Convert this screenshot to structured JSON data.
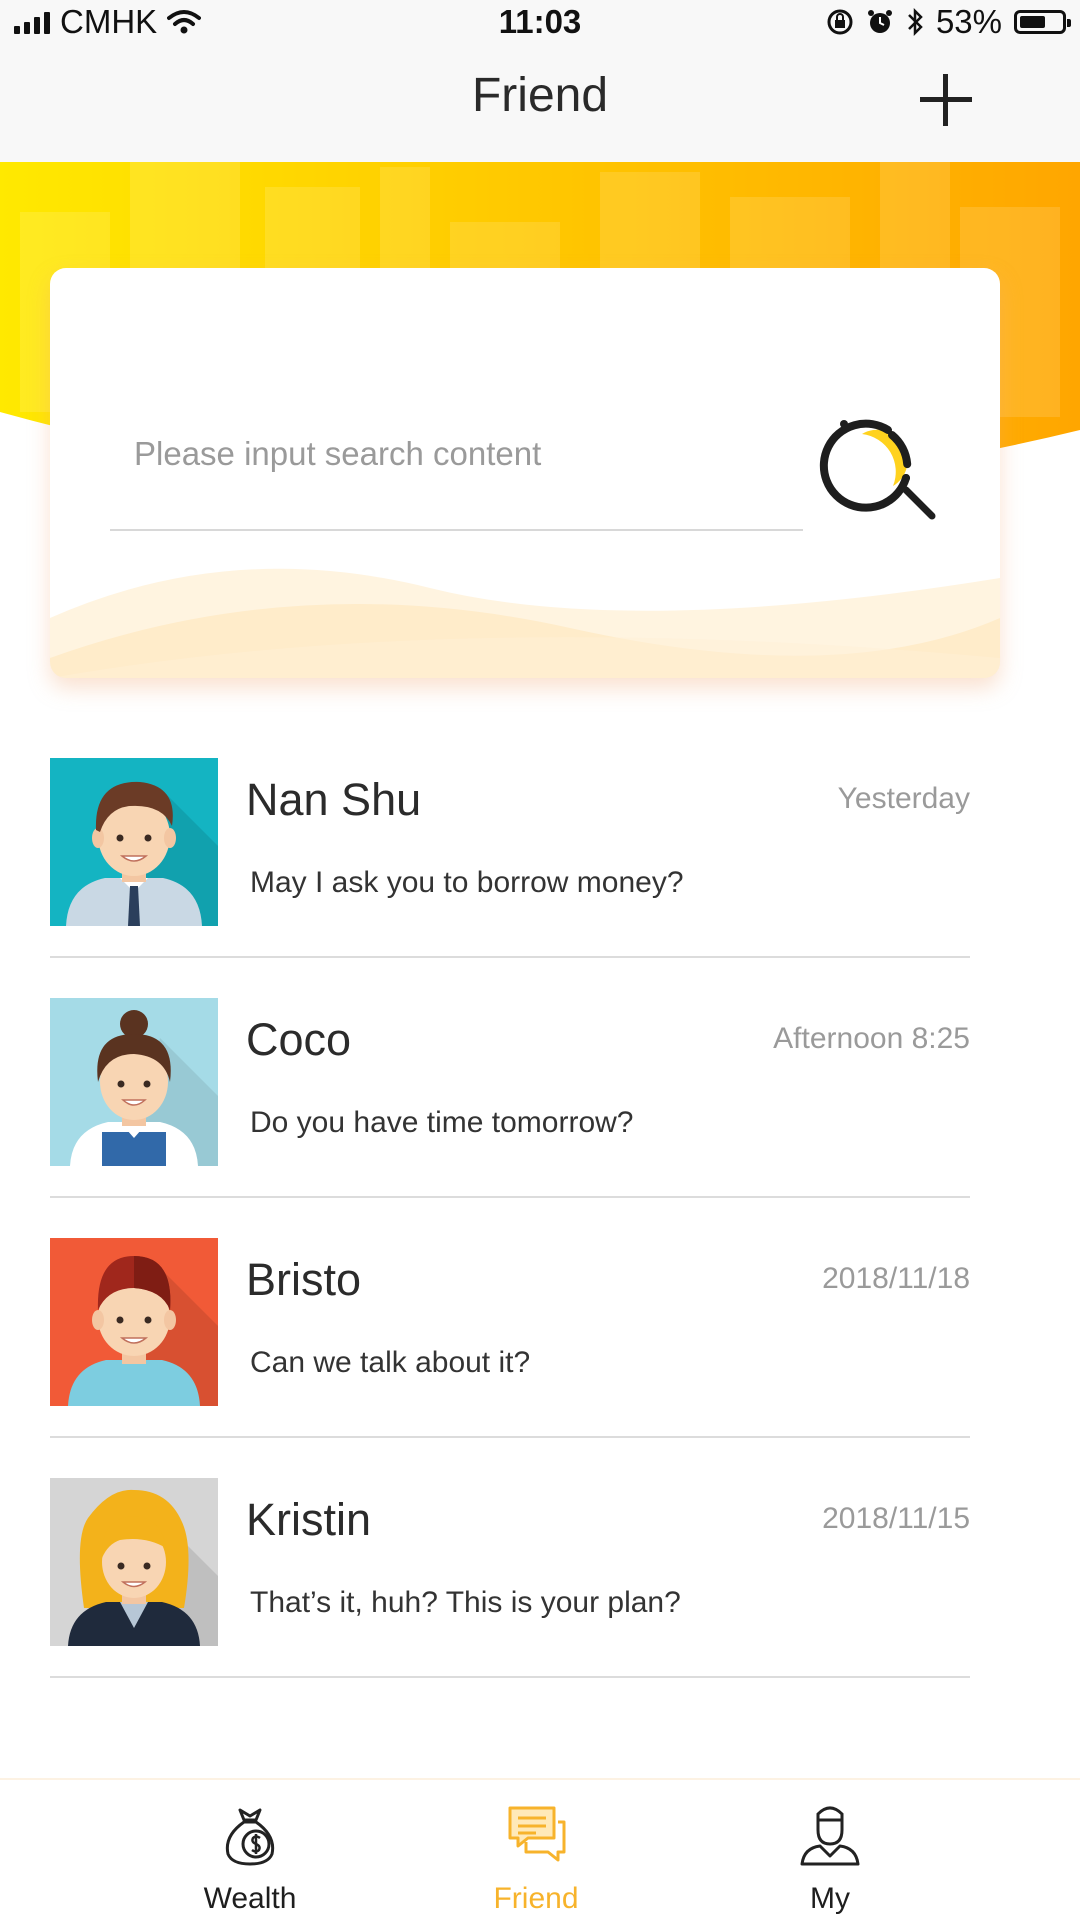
{
  "status_bar": {
    "carrier": "CMHK",
    "time": "11:03",
    "battery": "53%",
    "icons": [
      "signal-icon",
      "wifi-icon",
      "rotation-lock-icon",
      "alarm-icon",
      "bluetooth-icon",
      "battery-icon"
    ]
  },
  "nav": {
    "title": "Friend",
    "add_icon": "plus-icon"
  },
  "search": {
    "placeholder": "Please input search content",
    "icon": "search-icon"
  },
  "friends": [
    {
      "name": "Nan Shu",
      "time": "Yesterday",
      "message": "May I ask you to borrow money?",
      "avatar_bg": "#14b4c2"
    },
    {
      "name": "Coco",
      "time": "Afternoon 8:25",
      "message": "Do you have time tomorrow?",
      "avatar_bg": "#a5dbe7"
    },
    {
      "name": "Bristo",
      "time": "2018/11/18",
      "message": "Can we talk about it?",
      "avatar_bg": "#f15a37"
    },
    {
      "name": "Kristin",
      "time": "2018/11/15",
      "message": "That’s it, huh? This is your plan?",
      "avatar_bg": "#d5d5d5"
    }
  ],
  "tabs": [
    {
      "label": "Wealth",
      "icon": "money-bag-icon",
      "active": false
    },
    {
      "label": "Friend",
      "icon": "chat-icon",
      "active": true
    },
    {
      "label": "My",
      "icon": "user-icon",
      "active": false
    }
  ],
  "colors": {
    "accent": "#f7b32b",
    "banner_yellow": "#ffe600",
    "banner_orange": "#ffa800",
    "text_dark": "#2b2b2b",
    "text_muted": "#9a9a9a"
  }
}
